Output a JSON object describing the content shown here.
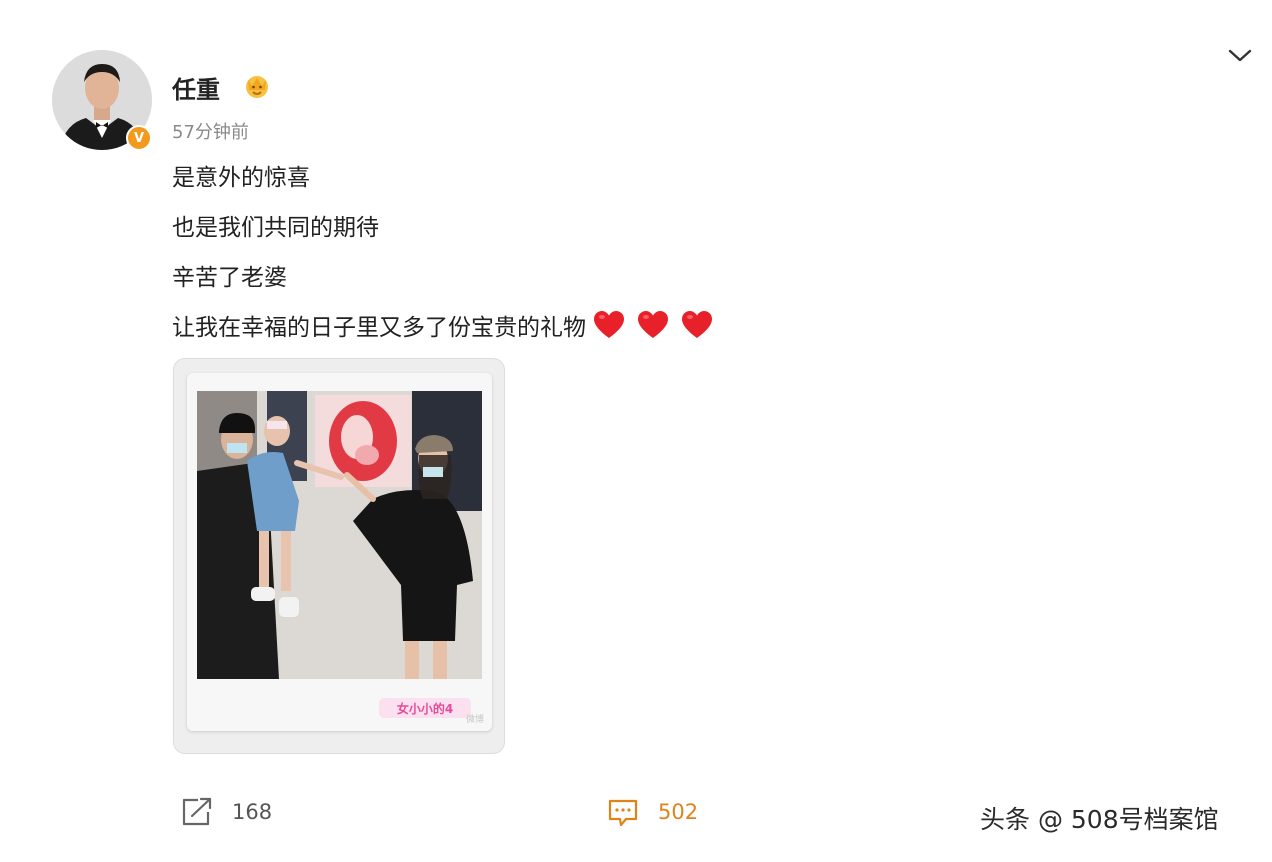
{
  "post": {
    "author": "任重",
    "timestamp": "57分钟前",
    "verified_mark": "V",
    "lines": [
      "是意外的惊喜",
      "也是我们共同的期待",
      "辛苦了老婆",
      "让我在幸福的日子里又多了份宝贵的礼物"
    ],
    "emoji": [
      "red-heart-icon",
      "red-heart-icon",
      "red-heart-icon"
    ],
    "photo": {
      "logo_text": "女小小的4",
      "watermark": "微博"
    }
  },
  "actions": {
    "repost_count": "168",
    "comment_count": "502"
  },
  "source_watermark": "头条 @ 508号档案馆",
  "colors": {
    "accent_orange": "#e0841a",
    "verified_badge": "#f39a1d",
    "heart_red": "#e8202a"
  }
}
